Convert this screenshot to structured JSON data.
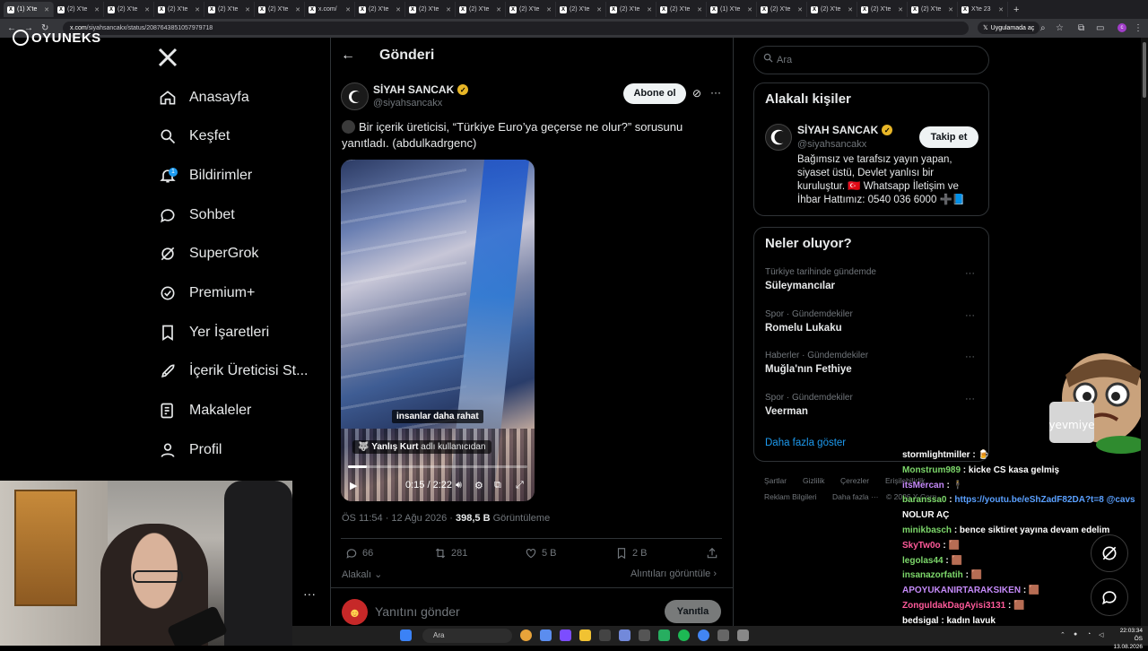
{
  "browser": {
    "tabs": [
      {
        "label": "(1) X'te",
        "active": true
      },
      {
        "label": "(2) X'te"
      },
      {
        "label": "(2) X'te"
      },
      {
        "label": "(2) X'te"
      },
      {
        "label": "(2) X'te"
      },
      {
        "label": "(2) X'te"
      },
      {
        "label": "x.com/"
      },
      {
        "label": "(2) X'te"
      },
      {
        "label": "(2) X'te"
      },
      {
        "label": "(2) X'te"
      },
      {
        "label": "(2) X'te"
      },
      {
        "label": "(2) X'te"
      },
      {
        "label": "(2) X'te"
      },
      {
        "label": "(2) X'te"
      },
      {
        "label": "(1) X'te"
      },
      {
        "label": "(2) X'te"
      },
      {
        "label": "(2) X'te"
      },
      {
        "label": "(2) X'te"
      },
      {
        "label": "(2) X'te"
      },
      {
        "label": "X'te 23"
      }
    ],
    "url_host": "x.com",
    "url_path": "/siyahsancakx/status/2087643851057979718",
    "app_pill": "Uygulamada aç"
  },
  "overlay": {
    "logo": "OYUNEKS"
  },
  "nav": {
    "items": [
      {
        "label": "Anasayfa",
        "icon": "home-icon"
      },
      {
        "label": "Keşfet",
        "icon": "search-icon"
      },
      {
        "label": "Bildirimler",
        "icon": "bell-icon",
        "badge": "1"
      },
      {
        "label": "Sohbet",
        "icon": "chat-icon"
      },
      {
        "label": "SuperGrok",
        "icon": "grok-icon"
      },
      {
        "label": "Premium+",
        "icon": "verified-icon"
      },
      {
        "label": "Yer İşaretleri",
        "icon": "bookmark-icon"
      },
      {
        "label": "İçerik Üreticisi St...",
        "icon": "rocket-icon"
      },
      {
        "label": "Makaleler",
        "icon": "article-icon"
      },
      {
        "label": "Profil",
        "icon": "person-icon"
      }
    ],
    "more": "···"
  },
  "post": {
    "page_title": "Gönderi",
    "author_name": "SİYAH SANCAK",
    "author_handle": "@siyahsancakx",
    "subscribe_label": "Abone ol",
    "text": "Bir içerik üreticisi, “Türkiye Euro’ya geçerse ne olur?” sorusunu yanıtladı. (abdulkadrgenc)",
    "video": {
      "caption": "insanlar daha rahat",
      "credit_user": "Yanlış Kurt",
      "credit_suffix": "adlı kullanıcıdan",
      "time": "0:15 / 2:22",
      "progress": 0.105
    },
    "timestamp": "ÖS 11:54 · 12 Ağu 2026 ·",
    "views": "398,5 B",
    "views_label": "Görüntüleme",
    "replies": "66",
    "reposts": "281",
    "likes": "5 B",
    "bookmarks": "2 B",
    "related_label": "Alakalı",
    "quotes_label": "Alıntıları görüntüle",
    "reply_placeholder": "Yanıtını gönder",
    "reply_button": "Yanıtla"
  },
  "sidebar": {
    "search_placeholder": "Ara",
    "related_title": "Alakalı kişiler",
    "related_person": {
      "name": "SİYAH SANCAK",
      "handle": "@siyahsancakx",
      "follow_label": "Takip et",
      "bio": "Bağımsız ve tarafsız yayın yapan, siyaset üstü, Devlet yanlısı bir kuruluştur. 🇹🇷 Whatsapp İletişim ve İhbar Hattımız: 0540 036 6000 ➕📘"
    },
    "trends_title": "Neler oluyor?",
    "trends": [
      {
        "context": "Türkiye tarihinde gündemde",
        "name": "Süleymancılar"
      },
      {
        "context": "Spor · Gündemdekiler",
        "name": "Romelu Lukaku"
      },
      {
        "context": "Haberler · Gündemdekiler",
        "name": "Muğla'nın Fethiye"
      },
      {
        "context": "Spor · Gündemdekiler",
        "name": "Veerman"
      }
    ],
    "show_more": "Daha fazla göster",
    "footer": [
      "Şartlar",
      "Gizlilik",
      "Çerezler",
      "Erişilebilirlik",
      "Reklam Bilgileri",
      "Daha fazla ···",
      "© 2026 X Corp."
    ]
  },
  "mascot_label": "yevmiye",
  "chat": [
    {
      "user": "stormlightmiller",
      "color": "#ffffff",
      "msg": ": 🍺"
    },
    {
      "user": "Monstrum989",
      "color": "#7dd86b",
      "msg": ": kicke CS kasa gelmiş"
    },
    {
      "user": "itsMercan",
      "color": "#c58af9",
      "msg": ": 🕴"
    },
    {
      "user": "baranssa0",
      "color": "#7dd86b",
      "msg": ":",
      "link": "https://youtu.be/eShZadF82DA?t=8 @cavs"
    },
    {
      "user": "",
      "color": "#ffffff",
      "msg": "NOLUR AÇ"
    },
    {
      "user": "minikbasch",
      "color": "#7dd86b",
      "msg": ": bence siktiret yayına devam edelim"
    },
    {
      "user": "SkyTw0o",
      "color": "#ff5a9a",
      "msg": ": 🟫"
    },
    {
      "user": "legolas44",
      "color": "#7dd86b",
      "msg": ": 🟫"
    },
    {
      "user": "insanazorfatih",
      "color": "#7dd86b",
      "msg": ": 🟫"
    },
    {
      "user": "APOYUKANIRTARAKSIKEN",
      "color": "#c58af9",
      "msg": ": 🟫"
    },
    {
      "user": "ZonguldakDagAyisi3131",
      "color": "#ff5a9a",
      "msg": ": 🟫"
    },
    {
      "user": "bedsigal",
      "color": "#ffffff",
      "msg": ": kadın lavuk"
    }
  ],
  "taskbar": {
    "search": "Ara",
    "time": "22:03:34 ÖS",
    "date": "13.08.2026"
  },
  "colors": {
    "accent": "#1d9bf0",
    "verified": "#e8b627",
    "border": "#2f3336",
    "muted": "#71767b"
  }
}
